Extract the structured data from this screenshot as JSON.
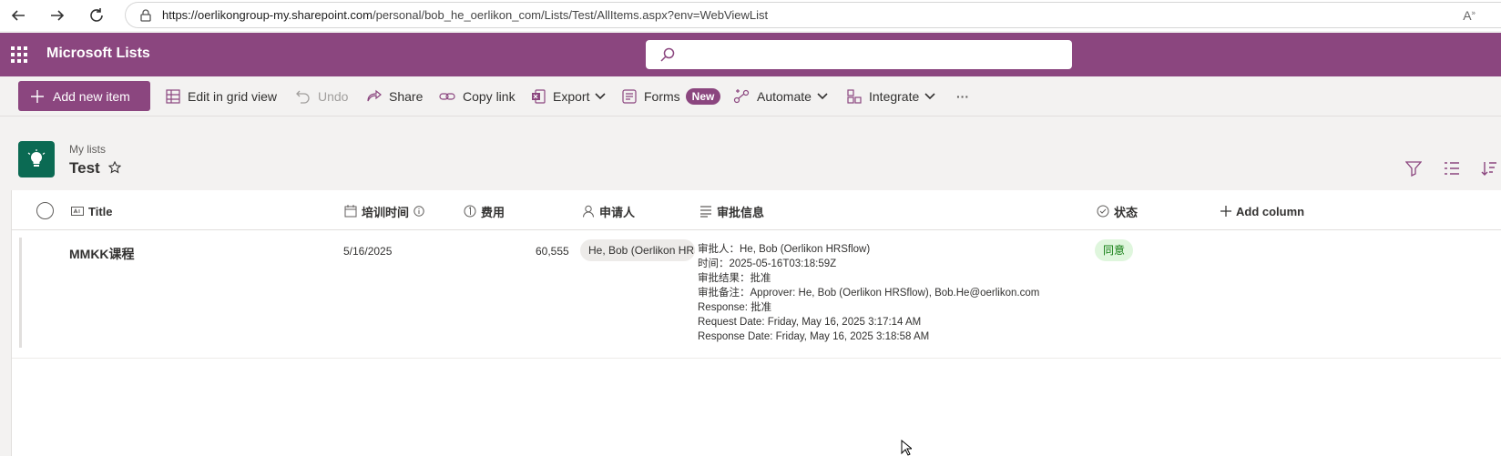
{
  "browser": {
    "url_host": "https://oerlikongroup-my.sharepoint.com",
    "url_path": "/personal/bob_he_oerlikon_com/Lists/Test/AllItems.aspx?env=WebViewList"
  },
  "suite": {
    "app_name": "Microsoft Lists",
    "search_placeholder": ""
  },
  "toolbar": {
    "add_new_item": "Add new item",
    "edit_grid": "Edit in grid view",
    "undo": "Undo",
    "share": "Share",
    "copy_link": "Copy link",
    "export": "Export",
    "forms": "Forms",
    "forms_badge": "New",
    "automate": "Automate",
    "integrate": "Integrate",
    "more": "···"
  },
  "list": {
    "breadcrumb": "My lists",
    "title": "Test"
  },
  "columns": {
    "title": "Title",
    "training_time": "培训时间",
    "cost": "费用",
    "requester": "申请人",
    "approval_info": "审批信息",
    "status": "状态",
    "add_column": "Add column"
  },
  "rows": [
    {
      "title": "MMKK课程",
      "training_time": "5/16/2025",
      "cost": "60,555",
      "requester": "He, Bob (Oerlikon HRSflow)",
      "approval_lines": [
        "审批人：He, Bob (Oerlikon HRSflow)",
        "时间：2025-05-16T03:18:59Z",
        "审批结果：批准",
        "审批备注：Approver: He, Bob (Oerlikon HRSflow), Bob.He@oerlikon.com",
        "Response: 批准",
        "Request Date: Friday, May 16, 2025 3:17:14 AM",
        "Response Date: Friday, May 16, 2025 3:18:58 AM"
      ],
      "status": "同意"
    }
  ],
  "colors": {
    "brand": "#8b467f",
    "list_icon": "#0b6a53",
    "status_bg": "#dff6dd",
    "status_fg": "#107c10"
  }
}
